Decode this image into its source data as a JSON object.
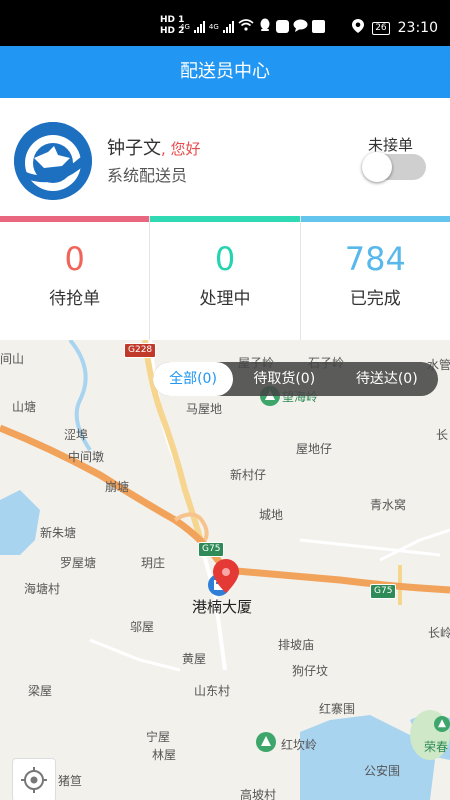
{
  "status_bar": {
    "hd1": "HD 1",
    "hd2": "HD 2",
    "net1": "4G",
    "net2": "4G",
    "battery": "26",
    "time": "23:10"
  },
  "header": {
    "title": "配送员中心"
  },
  "profile": {
    "name": "钟子文",
    "greeting": ", 您好",
    "role": "系统配送员",
    "toggle_label": "未接单",
    "toggle_on": false
  },
  "stats": [
    {
      "count": "0",
      "label": "待抢单",
      "color": "#f0645a",
      "bar_color": "#e9667f"
    },
    {
      "count": "0",
      "label": "处理中",
      "color": "#25d3b0",
      "bar_color": "#2ed9b4"
    },
    {
      "count": "784",
      "label": "已完成",
      "color": "#58b8ec",
      "bar_color": "#63c5ee"
    }
  ],
  "filters": [
    {
      "label": "全部(0)",
      "active": true
    },
    {
      "label": "待取货(0)",
      "active": false
    },
    {
      "label": "待送达(0)",
      "active": false
    }
  ],
  "map": {
    "place_labels": [
      "间山",
      "屋子岭",
      "石子岭",
      "水管",
      "望海岭",
      "马屋地",
      "山塘",
      "涩埠",
      "长",
      "中间墩",
      "屋地仔",
      "新村仔",
      "崩塘",
      "青水窝",
      "城地",
      "新朱塘",
      "罗屋塘",
      "玥庄",
      "海塘村",
      "邬屋",
      "排坡庙",
      "长岭",
      "黄屋",
      "狗仔坟",
      "山东村",
      "梁屋",
      "红寨围",
      "宁屋",
      "红坎岭",
      "荣春",
      "林屋",
      "公安围",
      "猪笪",
      "高坡村"
    ],
    "highlight_label": "港楠大厦",
    "road_badges": [
      "G228",
      "G75",
      "G75"
    ]
  },
  "colors": {
    "primary": "#2196f3",
    "marker": "#e53935"
  },
  "icons": {
    "locate": "locate-icon",
    "marker": "map-marker-icon",
    "avatar": "logo-icon"
  }
}
